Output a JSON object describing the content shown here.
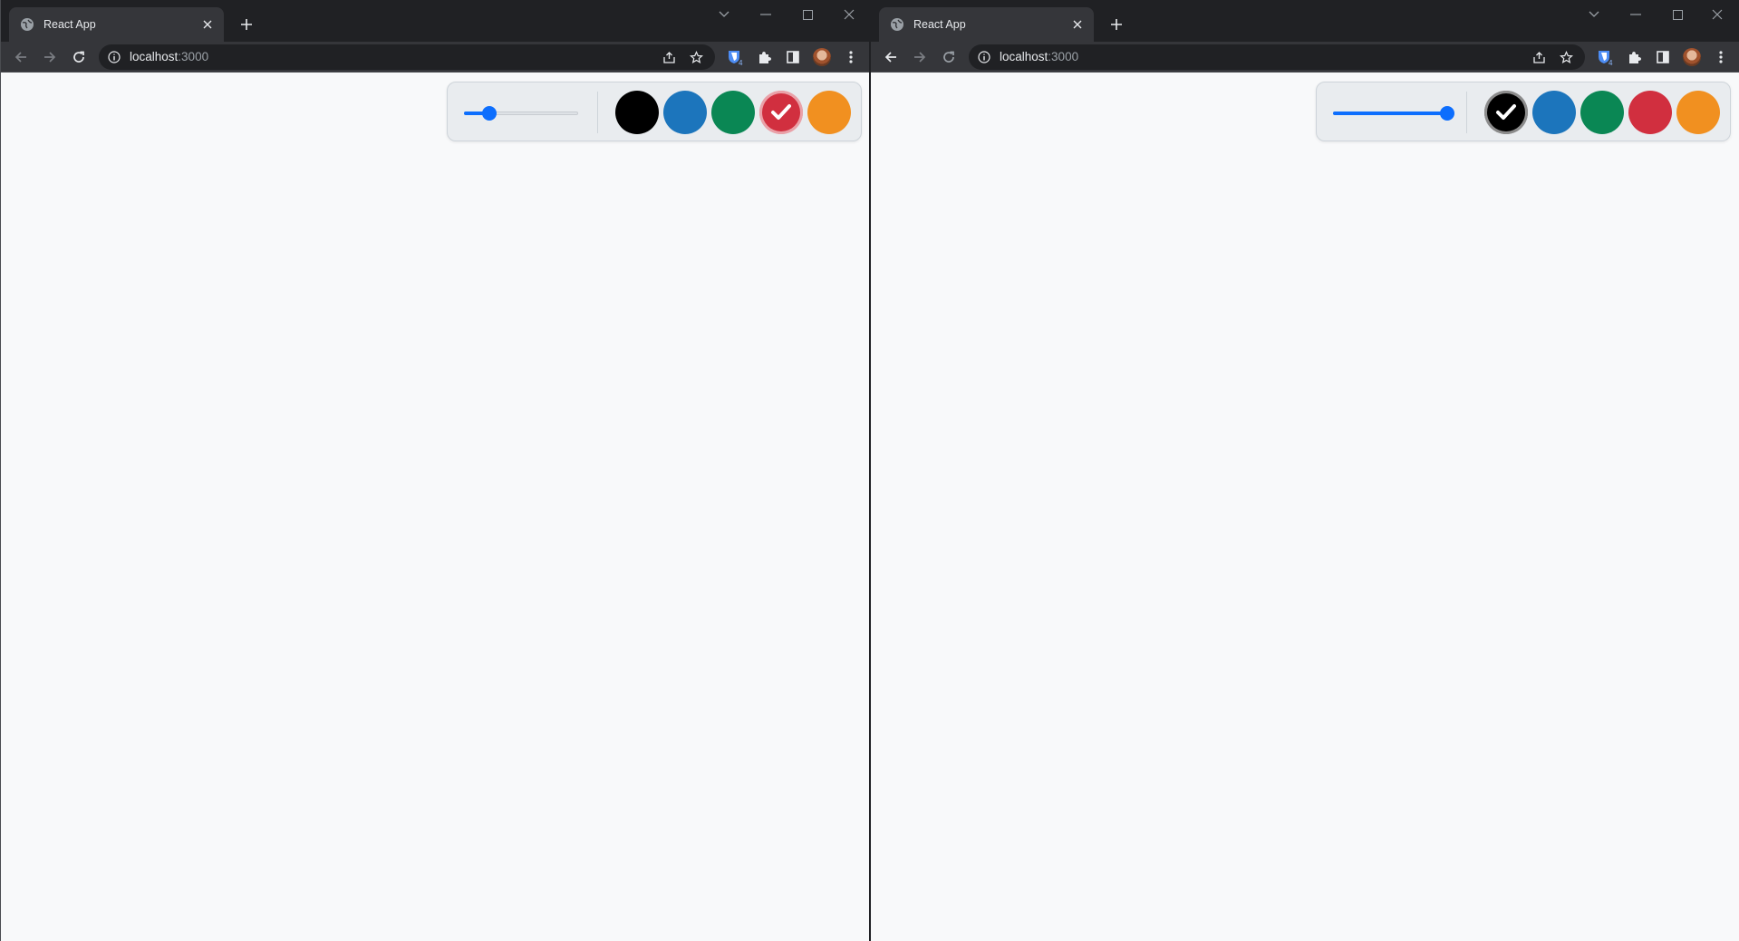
{
  "windows": [
    {
      "tab": {
        "title": "React App"
      },
      "address": {
        "host": "localhost",
        "port": ":3000"
      },
      "extension_badge": "4",
      "panel": {
        "stroke_width_level": 0.22,
        "colors": [
          {
            "name": "black",
            "hex": "#000000"
          },
          {
            "name": "blue",
            "hex": "#1c75bc"
          },
          {
            "name": "green",
            "hex": "#0a8754"
          },
          {
            "name": "red",
            "hex": "#d12f3f"
          },
          {
            "name": "orange",
            "hex": "#f19020"
          }
        ],
        "selected_color": "red"
      }
    },
    {
      "tab": {
        "title": "React App"
      },
      "address": {
        "host": "localhost",
        "port": ":3000"
      },
      "extension_badge": "4",
      "panel": {
        "stroke_width_level": 1.0,
        "colors": [
          {
            "name": "black",
            "hex": "#000000"
          },
          {
            "name": "blue",
            "hex": "#1c75bc"
          },
          {
            "name": "green",
            "hex": "#0a8754"
          },
          {
            "name": "red",
            "hex": "#d12f3f"
          },
          {
            "name": "orange",
            "hex": "#f19020"
          }
        ],
        "selected_color": "black"
      }
    }
  ],
  "theme": {
    "accent": "#0d6efd",
    "page_background": "#f8f9fa",
    "chrome_dark": "#202124",
    "chrome_toolbar": "#35363a"
  }
}
